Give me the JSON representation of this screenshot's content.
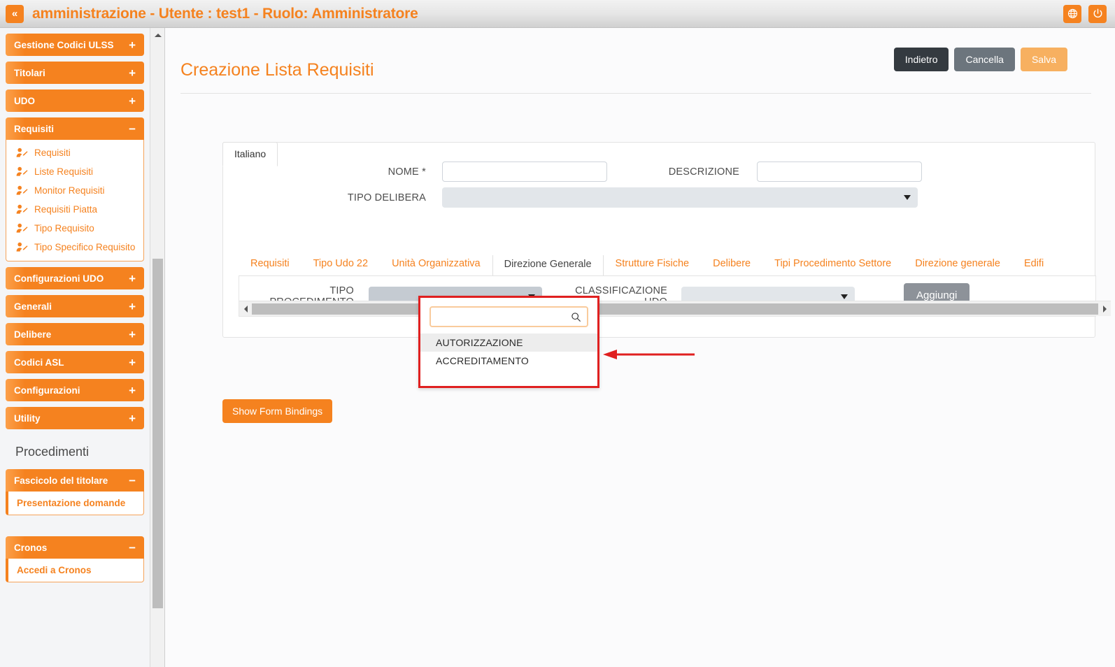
{
  "topbar": {
    "collapse_label": "«",
    "title": "amministrazione - Utente : test1 - Ruolo: Amministratore",
    "globe_icon": "globe-icon",
    "power_icon": "power-icon"
  },
  "sidebar": {
    "groups": [
      {
        "label": "Gestione Codici ULSS",
        "toggle": "+",
        "expanded": false
      },
      {
        "label": "Titolari",
        "toggle": "+",
        "expanded": false
      },
      {
        "label": "UDO",
        "toggle": "+",
        "expanded": false
      },
      {
        "label": "Requisiti",
        "toggle": "−",
        "expanded": true,
        "items": [
          {
            "label": "Requisiti",
            "icon": "user-edit-icon"
          },
          {
            "label": "Liste Requisiti",
            "icon": "user-edit-icon"
          },
          {
            "label": "Monitor Requisiti",
            "icon": "user-edit-icon"
          },
          {
            "label": "Requisiti Piatta",
            "icon": "user-edit-icon"
          },
          {
            "label": "Tipo Requisito",
            "icon": "user-edit-icon"
          },
          {
            "label": "Tipo Specifico Requisito",
            "icon": "user-edit-icon"
          }
        ]
      },
      {
        "label": "Configurazioni UDO",
        "toggle": "+",
        "expanded": false
      },
      {
        "label": "Generali",
        "toggle": "+",
        "expanded": false
      },
      {
        "label": "Delibere",
        "toggle": "+",
        "expanded": false
      },
      {
        "label": "Codici ASL",
        "toggle": "+",
        "expanded": false
      },
      {
        "label": "Configurazioni",
        "toggle": "+",
        "expanded": false
      },
      {
        "label": "Utility",
        "toggle": "+",
        "expanded": false
      }
    ],
    "section_label": "Procedimenti",
    "fascicolo": {
      "label": "Fascicolo del titolare",
      "toggle": "−",
      "item": "Presentazione domande"
    },
    "cronos": {
      "label": "Cronos",
      "toggle": "−",
      "item": "Accedi a Cronos"
    }
  },
  "page": {
    "title": "Creazione Lista Requisiti",
    "actions": {
      "back": "Indietro",
      "cancel": "Cancella",
      "save": "Salva"
    }
  },
  "form": {
    "lang_tab": "Italiano",
    "nome_label": "NOME *",
    "nome_value": "",
    "descrizione_label": "DESCRIZIONE",
    "descrizione_value": "",
    "tipo_delibera_label": "TIPO DELIBERA",
    "tipo_delibera_value": ""
  },
  "tabs": [
    {
      "label": "Requisiti",
      "active": false
    },
    {
      "label": "Tipo Udo 22",
      "active": false
    },
    {
      "label": "Unità Organizzativa",
      "active": false
    },
    {
      "label": "Direzione Generale",
      "active": true
    },
    {
      "label": "Strutture Fisiche",
      "active": false
    },
    {
      "label": "Delibere",
      "active": false
    },
    {
      "label": "Tipi Procedimento Settore",
      "active": false
    },
    {
      "label": "Direzione generale",
      "active": false
    },
    {
      "label": "Edifi",
      "active": false
    }
  ],
  "tab_panel": {
    "tipo_procedimento_label": "TIPO PROCEDIMENTO",
    "tipo_procedimento_value": "",
    "classificazione_udo_label": "CLASSIFICAZIONE UDO",
    "classificazione_udo_value": "",
    "add_button": "Aggiungi"
  },
  "dropdown": {
    "search_value": "",
    "search_placeholder": "",
    "search_icon": "search-icon",
    "options": [
      {
        "label": "AUTORIZZAZIONE",
        "highlighted": true
      },
      {
        "label": "ACCREDITAMENTO",
        "highlighted": false
      }
    ]
  },
  "footer": {
    "show_form_bindings": "Show Form Bindings"
  },
  "colors": {
    "accent_orange": "#f5821f",
    "annotation_red": "#e02020",
    "dark_button": "#343a40",
    "grey_button": "#6c757d",
    "save_button": "#f7b060"
  }
}
